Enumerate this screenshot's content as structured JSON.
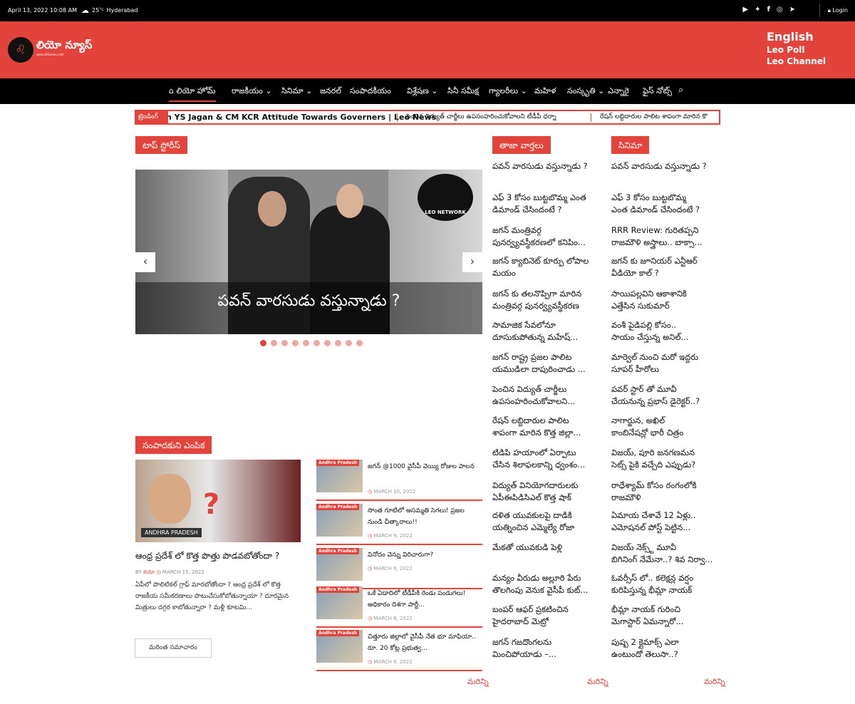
{
  "topbar": {
    "date": "April 13, 2022 10:08 AM",
    "temp": "25",
    "temp_unit": "°c",
    "city": "Hyderabad",
    "login": "Login",
    "social": [
      "youtube-icon",
      "twitter-icon",
      "facebook-icon",
      "instagram-icon",
      "telegram-icon"
    ]
  },
  "header": {
    "logo_text": "లియో న్యూస్",
    "logo_url": "www.LEOnews.com",
    "links": [
      "English",
      "Leo Poll",
      "Leo Channel"
    ]
  },
  "nav": [
    "లియో హోమ్",
    "రాజకీయం",
    "సినిమా",
    "జనరల్",
    "సంపాదకీయం",
    "విశ్లేషణ",
    "సినీ సమీక్ష",
    "గ్యాలరీలు",
    "మహిళ",
    "సంస్కృతి",
    "ఎన్నారై",
    "ఫైస్ నోట్స్"
  ],
  "ticker": {
    "label": "ట్రెండింగ్",
    "items": [
      "n YS Jagan & CM KCR Attitude Towards Governers | Leo News",
      "పెంచిన విద్యుత్ చార్జీలు ఉపసంహరించుకోవాలని టీడీపీ ధర్నా",
      "రేషన్ లబ్దిదారుల పాలిట శాపంగా మారిన కొ"
    ]
  },
  "top_stories": {
    "heading": "టాప్ స్టోరీస్",
    "caption": "పవన్ వారసుడు వస్తున్నాడు ?",
    "badge": "LEO NETWORK",
    "dots": 10,
    "active_dot": 0
  },
  "editor": {
    "heading": "సంపాదకుని ఎంపిక",
    "category": "ANDHRA PRADESH",
    "title": "ఆంధ్ర ప్రదేశ్ లో కొత్త పొత్తు పొడవబోతోందా ?",
    "by": "BY",
    "author": "లియో",
    "date": "MARCH 15, 2022",
    "excerpt": "ఏపీలో పొలిటికల్ గ్రాఫ్ మారబోతోందా ? ఆంధ్ర ప్రదేశ్ లో కొత్త రాజకీయ సమీకరణాలు పొటుచేసుకోబోతున్నాయా ? దూరమైన మిత్రులు దగ్గర కాబోతున్నారా ? మళ్లీ కూటమి...",
    "more_button": "మరింత సమాచారం"
  },
  "side_list": [
    {
      "cat": "Andhra Pradesh",
      "title": "జగన్ @1000 వైసీపీ వెయ్యి రోజుల పాలన",
      "date": "MARCH 10, 2022"
    },
    {
      "cat": "Andhra Pradesh",
      "title": "సొంత గూటిలో అసమ్మతి సెగలు! ప్రజల నుండి ఛీత్కారాలు!!",
      "date": "MARCH 9, 2022"
    },
    {
      "cat": "Andhra Pradesh",
      "title": "వినోదం వెన్ను విరిచారుగా?",
      "date": "MARCH 9, 2022"
    },
    {
      "cat": "Andhra Pradesh",
      "title": "ఒకే ఏడాదిలో టీడీపీకి రెండు పండుగలు! అధికారం దిశగా పార్టీ...",
      "date": "MARCH 8, 2022"
    },
    {
      "cat": "Andhra Pradesh",
      "title": "చిత్తూరు జిల్లాలో వైసీపీ నేత భూ మాఫియా.. రూ. 20 కోట్ల ప్రభుత్వ...",
      "date": "MARCH 8, 2022"
    }
  ],
  "latest": {
    "heading": "తాజా వార్తలు",
    "items": [
      [
        "పవన్ వారసుడు వస్తున్నాడు ?"
      ],
      [
        "ఎఫ్ 3 కోసం బుట్టబొమ్మ ఎంత",
        "డిమాండ్ చేసిందంటే ?"
      ],
      [
        "జగన్ మంత్రివర్గ",
        "పునర్వ్యవస్థీకరణలో కనిపిం..."
      ],
      [
        "జగన్ క్యాబినెట్ కూర్పు లోపాల",
        "మయం"
      ],
      [
        "జగన్ కు తలనొప్పిగా మారిన",
        "మంత్రివర్గ పునర్వ్యవస్థీకరణ"
      ],
      [
        "సామాజిక సేవలోనూ",
        "దూసుకుపోతున్న మహేష్..."
      ],
      [
        "జగన్ రాష్ట్ర ప్రజల పాలిట",
        "యముడిలా దాపురించాడు ..."
      ],
      [
        "పెంచిన విద్యుత్ చార్జీలు",
        "ఉపసంహరించుకోవాలని..."
      ],
      [
        "రేషన్ లబ్దిదారుల పాలిట",
        "శాపంగా మారిన కొత్త జిల్లా..."
      ],
      [
        "టిడిపి హయాంలో ఏర్పాటు",
        "చేసిన శిలాఫలకాన్ని ధ్వంశం..."
      ],
      [
        "విద్యుత్ వినియోగదారులకు",
        "ఏపీఈపిడిసిఎల్ కొత్త షాక్"
      ],
      [
        "దళిత యువకులపై దాడికి",
        "యత్నించిన ఎమ్మెల్యే రోజా"
      ],
      [
        "మేకతో యువకుడి పెళ్లి"
      ],
      [
        "మన్యం వీరుడు అల్లూరి పేరు",
        "తొలగింపు వెనుక వైసీపీ కుట్..."
      ],
      [
        "బంపర్ ఆఫర్ ప్రకటించిన",
        "హైదరాబాద్ మెట్రో"
      ],
      [
        "జగన్ గజదొంగలను",
        "మించిపోయాడు –..."
      ]
    ],
    "more": "మరిన్ని"
  },
  "cinema": {
    "heading": "సినిమా",
    "items": [
      [
        "పవన్ వారసుడు వస్తున్నాడు ?"
      ],
      [
        "ఎఫ్ 3 కోసం బుట్టబొమ్మ",
        "ఎంత డిమాండ్ చేసిందంటే ?"
      ],
      [
        "RRR Review: గురితప్పని",
        "రాజమౌళి అస్త్రాలు.. బాక్సా..."
      ],
      [
        "జగన్ కు జూనియర్ ఎన్టీఆర్",
        "వీడియో కాల్ ?"
      ],
      [
        "సాయిపల్లవిని ఆకాశానికి",
        "ఎత్తేసిన సుకుమార్"
      ],
      [
        "వంశీ పైడిపల్లి కోసం..",
        "సాయం చేస్తున్న అనిల్..."
      ],
      [
        "మార్వెల్ నుంచి మరో ఇద్దరు",
        "సూపర్ హీరోలు"
      ],
      [
        "పవర్ స్టార్ తో మూవీ",
        "చేయనున్న ప్రభాస్ డైరెక్టర్..?"
      ],
      [
        "నాగార్జున, అఖిల్",
        "కాంబినేషన్లో భారీ చిత్రం"
      ],
      [
        "విజయ్, పూరి జనగణమన",
        "సెట్స్ పైకి వచ్చేది ఎప్పుడు?"
      ],
      [
        "రాధేశ్యామ్ కోసం రంగంలోకి",
        "రాజమౌళి"
      ],
      [
        "ఏమాయ చేశావే 12 ఏళ్లు..",
        "ఎమోషనల్ పోస్ట్ పెట్టిన..."
      ],
      [
        "విజయ్ నెక్స్ట్ మూవీ",
        "బిగినింగ్ నేమేనా..? శివ నిర్వా..."
      ],
      [
        "ఓవర్సీస్ లో.. కలెక్షన్ల వర్షం",
        "కురిపిస్తున్న భీమ్లా నాయక్"
      ],
      [
        "భీమ్లా నాయక్ గురించి",
        "మెగాస్టార్ ఏమన్నారో..."
      ],
      [
        "పుష్ప 2 క్లైమాక్స్ ఎలా",
        "ఉంటుందో తెలుసా..?"
      ]
    ],
    "more": "మరిన్ని"
  },
  "third_more": "మరిన్ని",
  "colors": {
    "accent": "#e2433a",
    "topbar": "#000000"
  }
}
